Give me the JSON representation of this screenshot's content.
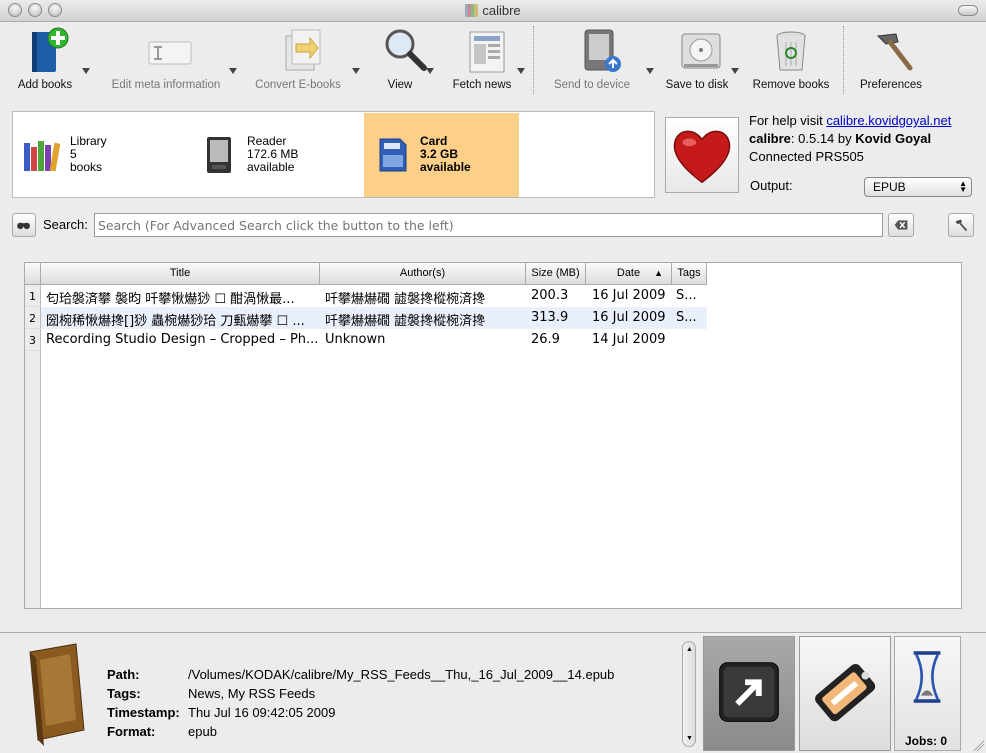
{
  "window": {
    "title": "calibre"
  },
  "toolbar": {
    "items": [
      {
        "label": "Add books",
        "icon": "add-books-icon",
        "enabled": true
      },
      {
        "label": "Edit meta information",
        "icon": "edit-metadata-icon",
        "enabled": false
      },
      {
        "label": "Convert E-books",
        "icon": "convert-icon",
        "enabled": false
      },
      {
        "label": "View",
        "icon": "magnifier-icon",
        "enabled": true
      },
      {
        "label": "Fetch news",
        "icon": "newspaper-icon",
        "enabled": true
      },
      {
        "label": "Send to device",
        "icon": "send-to-device-icon",
        "enabled": false
      },
      {
        "label": "Save to disk",
        "icon": "hard-disk-icon",
        "enabled": true
      },
      {
        "label": "Remove books",
        "icon": "trash-icon",
        "enabled": true
      },
      {
        "label": "Preferences",
        "icon": "hammer-icon",
        "enabled": true
      }
    ]
  },
  "devices": [
    {
      "line1": "Library",
      "line2": "5",
      "line3": "books",
      "icon": "library-books-icon",
      "selected": false
    },
    {
      "line1": "Reader",
      "line2": "172.6 MB",
      "line3": "available",
      "icon": "ereader-icon",
      "selected": false
    },
    {
      "line1": "Card",
      "line2": "3.2 GB",
      "line3": "available",
      "icon": "sd-card-icon",
      "selected": true
    }
  ],
  "info": {
    "help_prefix": "For help visit ",
    "help_link": "calibre.kovidgoyal.net",
    "app_name": "calibre",
    "version_text": ": 0.5.14 by ",
    "author": "Kovid Goyal",
    "status": "Connected PRS505",
    "output_label": "Output:",
    "output_value": "EPUB"
  },
  "search": {
    "label": "Search:",
    "placeholder": "Search (For Advanced Search click the button to the left)"
  },
  "table": {
    "columns": [
      "Title",
      "Author(s)",
      "Size (MB)",
      "Date",
      "Tags"
    ],
    "rows": [
      {
        "num": "1",
        "title": "匂珨褩済攀  褩昀  吀攀愀爀猀  ☐  酣渦愀最...",
        "author": "吀攀爀爀礀  譃褩搀樅椀済搀",
        "size": "200.3",
        "date": "16 Jul 2009",
        "tags": "S..."
      },
      {
        "num": "2",
        "title": "圀椀稀愀爀搀[]猀  蟲椀爀猀珨  刀甀爀攀  ☐  ...",
        "author": "吀攀爀爀礀  譃褩搀樅椀済搀",
        "size": "313.9",
        "date": "16 Jul 2009",
        "tags": "S..."
      },
      {
        "num": "3",
        "title": "Recording Studio Design – Cropped – Ph...",
        "author": "Unknown",
        "size": "26.9",
        "date": "14 Jul 2009",
        "tags": ""
      }
    ]
  },
  "details": {
    "path_label": "Path:",
    "path": "/Volumes/KODAK/calibre/My_RSS_Feeds__Thu,_16_Jul_2009__14.epub",
    "tags_label": "Tags:",
    "tags": "News, My RSS Feeds",
    "timestamp_label": "Timestamp:",
    "timestamp": "Thu Jul 16 09:42:05 2009",
    "format_label": "Format:",
    "format": "epub"
  },
  "jobs": {
    "label": "Jobs: 0"
  }
}
